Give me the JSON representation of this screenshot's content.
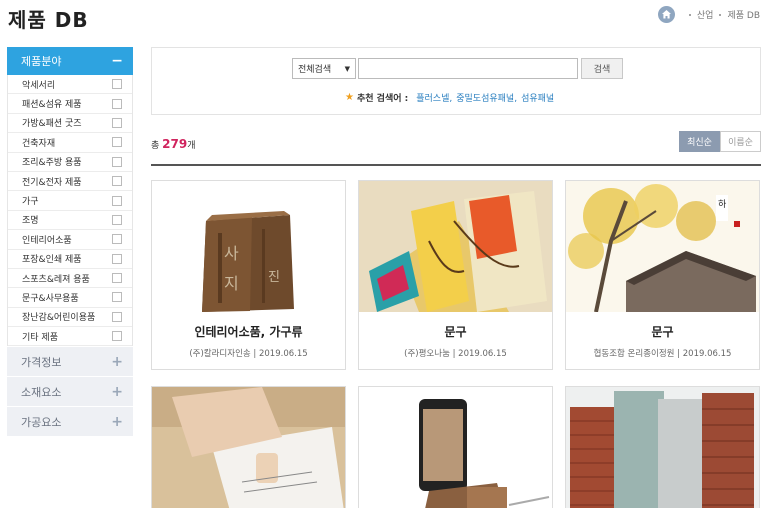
{
  "header": {
    "title": "제품 DB",
    "breadcrumb": [
      "산업",
      "제품 DB"
    ]
  },
  "sidebar": {
    "section_title": "제품분야",
    "items": [
      {
        "label": "악세서리"
      },
      {
        "label": "패션&섬유 제품"
      },
      {
        "label": "가방&패션 굿즈"
      },
      {
        "label": "건축자재"
      },
      {
        "label": "조리&주방 용품"
      },
      {
        "label": "전기&전자 제품"
      },
      {
        "label": "가구"
      },
      {
        "label": "조명"
      },
      {
        "label": "인테리어소품"
      },
      {
        "label": "포장&인쇄 제품"
      },
      {
        "label": "스포츠&레져 용품"
      },
      {
        "label": "문구&사무용품"
      },
      {
        "label": "장난감&어린이용품"
      },
      {
        "label": "기타 제품"
      }
    ],
    "categories": [
      {
        "label": "가격정보"
      },
      {
        "label": "소재요소"
      },
      {
        "label": "가공요소"
      }
    ]
  },
  "search": {
    "select_value": "전체검색",
    "input_value": "",
    "button_label": "검색",
    "recommend_label": "추천 검색어 :",
    "keywords": [
      "플러스넬,",
      "중밀도섬유패널,",
      "섬유패널"
    ]
  },
  "results": {
    "count_prefix": "총",
    "count": "279",
    "count_suffix": "개",
    "sort": [
      "최신순",
      "이름순"
    ]
  },
  "cards": [
    {
      "title": "인테리어소품, 가구류",
      "meta": "(주)칼라디자인송 | 2019.06.15"
    },
    {
      "title": "문구",
      "meta": "(주)평오나눔 | 2019.06.15"
    },
    {
      "title": "문구",
      "meta": "협동조합 온리종이정원 | 2019.06.15"
    },
    {
      "title": "",
      "meta": ""
    },
    {
      "title": "",
      "meta": ""
    },
    {
      "title": "",
      "meta": ""
    }
  ],
  "colors": {
    "accent": "#2ea3e0",
    "count": "#d0245e",
    "keyword": "#2a7fc0"
  }
}
